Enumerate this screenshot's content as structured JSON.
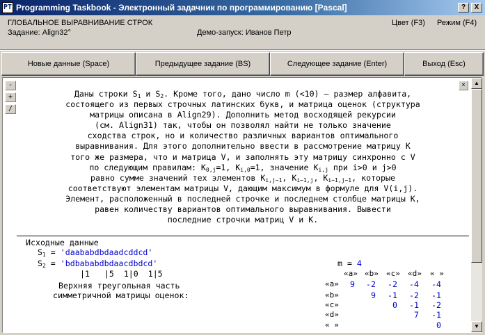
{
  "window": {
    "title": "Programming Taskbook - Электронный задачник по программированию [Pascal]",
    "app_icon": "PT",
    "help_glyph": "?",
    "close_glyph": "X"
  },
  "info": {
    "heading": "ГЛОБАЛЬНОЕ ВЫРАВНИВАНИЕ СТРОК",
    "task": "Задание: Align32°",
    "demo": "Демо-запуск: Иванов Петр",
    "color_mode": "Цвет (F3)",
    "view_mode": "Режим (F4)"
  },
  "buttons": {
    "new_data": "Новые данные (Space)",
    "prev_task": "Предыдущее задание (BS)",
    "next_task": "Следующее задание (Enter)",
    "exit": "Выход (Esc)"
  },
  "side_buttons": [
    "-",
    "+",
    "/"
  ],
  "close_panel_glyph": "×",
  "task_text": [
    [
      "Даны строки S",
      "1",
      " и S",
      "2",
      ". Кроме того, дано число m (<10) — размер алфавита,"
    ],
    [
      "состоящего из первых строчных латинских букв, и матрица оценок (структура"
    ],
    [
      "матрицы описана в Align29). Дополнить метод восходящей рекурсии"
    ],
    [
      "(см. Align31) так, чтобы он позволял найти не только значение"
    ],
    [
      "сходства строк, но и количество различных вариантов оптимального"
    ],
    [
      "выравнивания. Для этого дополнительно ввести в рассмотрение матрицу K"
    ],
    [
      "того же размера, что и матрица V, и заполнять эту матрицу синхронно с V"
    ],
    [
      "по следующим правилам: K",
      "0,j",
      "=1, K",
      "i,0",
      "=1, значение K",
      "i,j",
      " при i>0 и j>0"
    ],
    [
      "равно сумме значений тех элементов K",
      "i,j−1",
      ", K",
      "i−1,j",
      ", K",
      "i−1,j−1",
      ", которые"
    ],
    [
      "соответствуют элементам матрицы V, дающим максимум в формуле для V(i,j)."
    ],
    [
      "Элемент, расположенный в последней строчке и последнем столбце матрицы K,"
    ],
    [
      "равен количеству вариантов оптимального выравнивания. Вывести"
    ],
    [
      "последние строчки матриц V и K."
    ]
  ],
  "input": {
    "heading": "Исходные данные",
    "s1_label": "S",
    "s1_sub": "1",
    "s1_eq": " = ",
    "s1_value": "'daababdbdaadcddcd'",
    "s2_label": "S",
    "s2_sub": "2",
    "s2_eq": " = ",
    "s2_value": "'bdbababdbdaacdbdcd'",
    "ruler": "|1   |5  1|0  1|5",
    "m_label": "m = ",
    "m_value": "4",
    "matrix_caption_1": "Верхняя треугольная часть",
    "matrix_caption_2": "симметричной матрицы оценок:"
  },
  "matrix": {
    "col_headers": [
      "«a»",
      "«b»",
      "«c»",
      "«d»",
      "« »"
    ],
    "row_headers": [
      "«a»",
      "«b»",
      "«c»",
      "«d»",
      "« »"
    ],
    "rows": [
      [
        "9",
        "-2",
        "-2",
        "-4",
        "-4"
      ],
      [
        "",
        "9",
        "-1",
        "-2",
        "-1"
      ],
      [
        "",
        "",
        "0",
        "-1",
        "-2"
      ],
      [
        "",
        "",
        "",
        "7",
        "-1"
      ],
      [
        "",
        "",
        "",
        "",
        "0"
      ]
    ]
  }
}
